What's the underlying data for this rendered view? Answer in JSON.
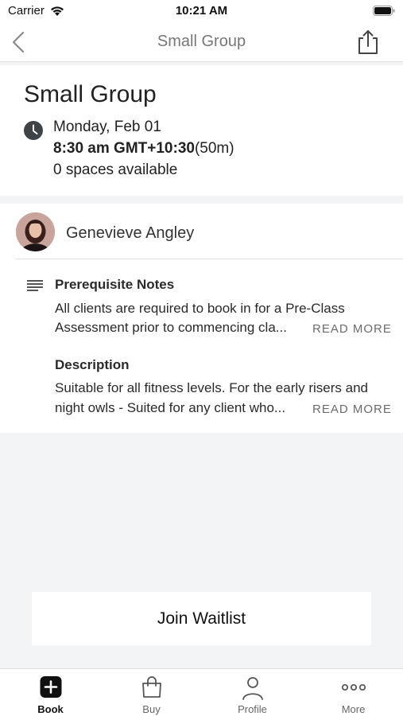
{
  "status_bar": {
    "carrier": "Carrier",
    "time": "10:21 AM"
  },
  "nav": {
    "title": "Small Group"
  },
  "class_info": {
    "title": "Small Group",
    "date": "Monday, Feb 01",
    "time": "8:30 am GMT+10:30",
    "duration": "(50m)",
    "spaces": "0 spaces available"
  },
  "instructor": {
    "name": "Genevieve Angley"
  },
  "prerequisite": {
    "heading": "Prerequisite Notes",
    "line1": "All clients are required to book in for a Pre-Class",
    "line2": "Assessment prior to commencing cla...",
    "read_more": "READ MORE"
  },
  "description": {
    "heading": "Description",
    "line1": "Suitable for all fitness levels. For the early risers and",
    "line2": "night owls - Suited for any client who...",
    "read_more": "READ MORE"
  },
  "action": {
    "label": "Join Waitlist"
  },
  "tabs": [
    {
      "label": "Book",
      "icon": "plus-square-icon",
      "active": true
    },
    {
      "label": "Buy",
      "icon": "shopping-bag-icon",
      "active": false
    },
    {
      "label": "Profile",
      "icon": "person-icon",
      "active": false
    },
    {
      "label": "More",
      "icon": "ellipsis-icon",
      "active": false
    }
  ],
  "colors": {
    "background": "#f3f4f6",
    "card": "#ffffff",
    "muted_text": "#777777"
  }
}
